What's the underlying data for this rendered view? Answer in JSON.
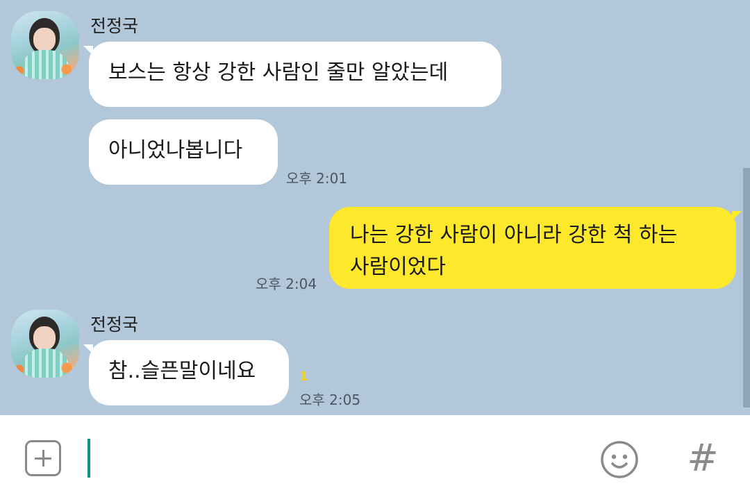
{
  "chat": {
    "messages": [
      {
        "sender": "전정국",
        "text": "보스는 항상 강한 사람인 줄만 알았는데"
      },
      {
        "text": "아니었나봅니다",
        "time": "오후 2:01"
      },
      {
        "text_line1": "나는 강한 사람이 아니라 강한 척 하는",
        "text_line2": "사람이었다",
        "time": "오후 2:04"
      },
      {
        "sender": "전정국",
        "text": "참..슬픈말이네요",
        "unread": "1",
        "time": "오후 2:05"
      }
    ]
  },
  "input": {
    "plus_icon": "plus-square-icon",
    "emoji_icon": "smiley-icon",
    "hash_label": "#"
  },
  "colors": {
    "background": "#b2c7d9",
    "my_bubble": "#fee82b",
    "their_bubble": "#ffffff",
    "cursor": "#16968a"
  }
}
